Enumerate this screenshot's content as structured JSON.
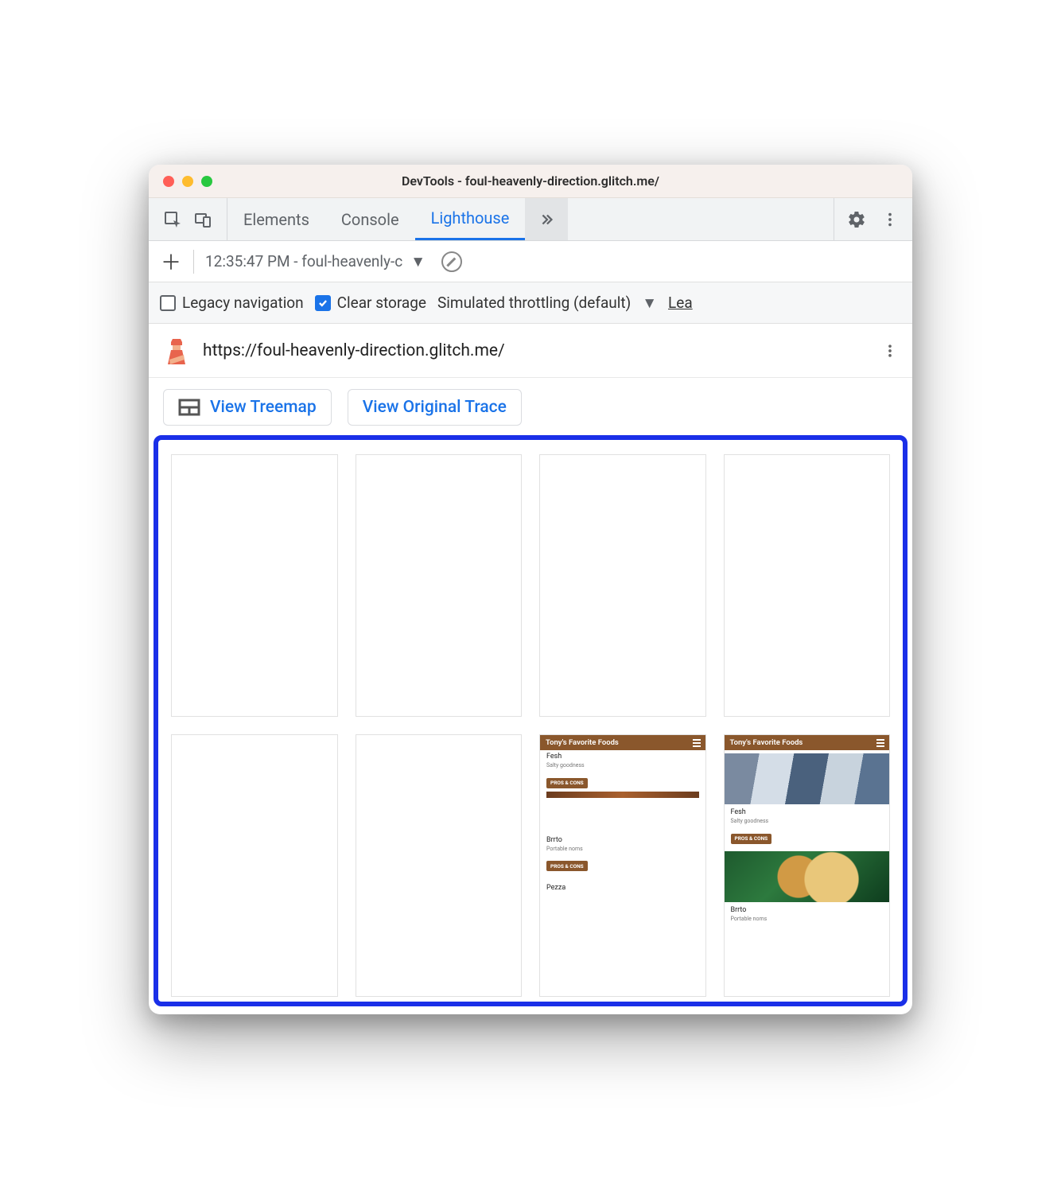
{
  "window": {
    "title": "DevTools - foul-heavenly-direction.glitch.me/"
  },
  "tabs": {
    "items": [
      "Elements",
      "Console",
      "Lighthouse"
    ],
    "active": 2
  },
  "report_select": {
    "label": "12:35:47 PM - foul-heavenly-c"
  },
  "options": {
    "legacy": {
      "label": "Legacy navigation",
      "checked": false
    },
    "clear": {
      "label": "Clear storage",
      "checked": true
    },
    "throttle": "Simulated throttling (default)",
    "learn": "Lea"
  },
  "url": "https://foul-heavenly-direction.glitch.me/",
  "views": {
    "treemap": "View Treemap",
    "trace": "View Original Trace"
  },
  "filmstrip": {
    "header": "Tony's Favorite Foods",
    "items": [
      {
        "name": "Fesh",
        "sub": "Salty goodness",
        "chip": "PROS & CONS",
        "imgClass": "fish"
      },
      {
        "name": "Brrto",
        "sub": "Portable noms",
        "chip": "PROS & CONS",
        "imgClass": "burrito"
      },
      {
        "name": "Pezza",
        "sub": "",
        "chip": ""
      }
    ]
  }
}
